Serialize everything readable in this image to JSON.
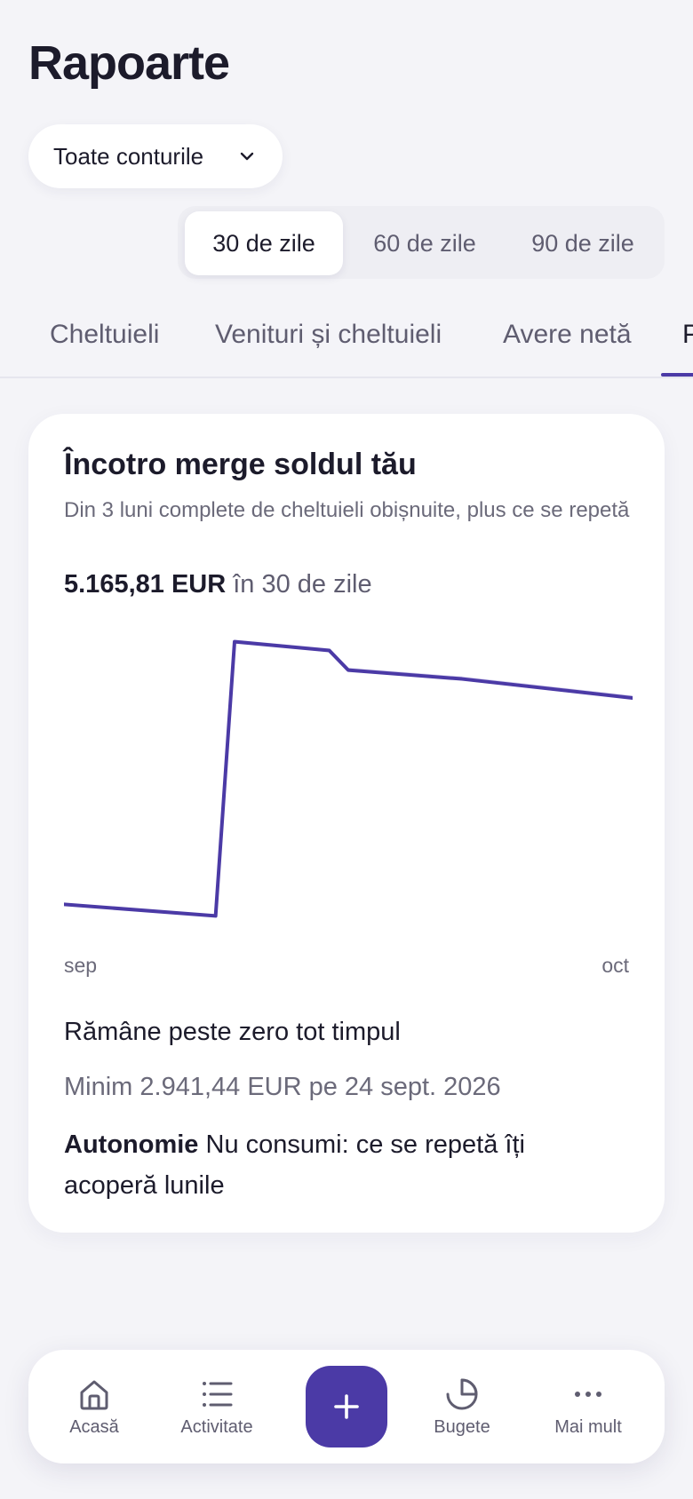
{
  "header": {
    "title": "Rapoarte"
  },
  "account_filter": {
    "label": "Toate conturile"
  },
  "period": {
    "options": [
      "30 de zile",
      "60 de zile",
      "90 de zile"
    ],
    "selected": "30 de zile"
  },
  "tabs": {
    "items": [
      "Cheltuieli",
      "Venituri și cheltuieli",
      "Avere netă",
      "P"
    ],
    "active": "P"
  },
  "forecast_card": {
    "title": "Încotro merge soldul tău",
    "subtitle": "Din 3 luni complete de cheltuieli obișnuite, plus ce se repetă",
    "projection_amount": "5.165,81 EUR",
    "projection_suffix": "în 30 de zile",
    "status": "Rămâne peste zero tot timpul",
    "minimum": "Minim 2.941,44 EUR pe 24 sept. 2026",
    "autonomy_label": "Autonomie",
    "autonomy_text": "Nu consumi: ce se repetă îți acoperă lunile"
  },
  "chart_data": {
    "type": "line",
    "x_labels": [
      "sep",
      "oct"
    ],
    "x_days": [
      0,
      8,
      9,
      14,
      15,
      21,
      30
    ],
    "values": [
      3060,
      2941.44,
      5740,
      5650,
      5450,
      5360,
      5165.81
    ],
    "band_upper": [
      3060,
      2941.44,
      5760,
      5670,
      5475,
      5385,
      5190
    ],
    "band_lower": [
      3060,
      2941.44,
      5725,
      5635,
      5435,
      5345,
      5150
    ],
    "ylim": [
      2900,
      5800
    ],
    "series_color": "#4b3aa6",
    "band_color": "#d6d1ee",
    "grid": false,
    "legend": "none"
  },
  "bottom_nav": {
    "items": [
      {
        "label": "Acasă",
        "icon": "home-icon"
      },
      {
        "label": "Activitate",
        "icon": "list-icon"
      },
      {
        "label": "",
        "icon": "plus-icon"
      },
      {
        "label": "Bugete",
        "icon": "pie-chart-icon"
      },
      {
        "label": "Mai mult",
        "icon": "more-icon"
      }
    ]
  },
  "colors": {
    "accent": "#4b3aa6",
    "background": "#f4f4f8",
    "card": "#ffffff",
    "text_primary": "#1c1b2b",
    "text_secondary": "#6b6a7a"
  }
}
